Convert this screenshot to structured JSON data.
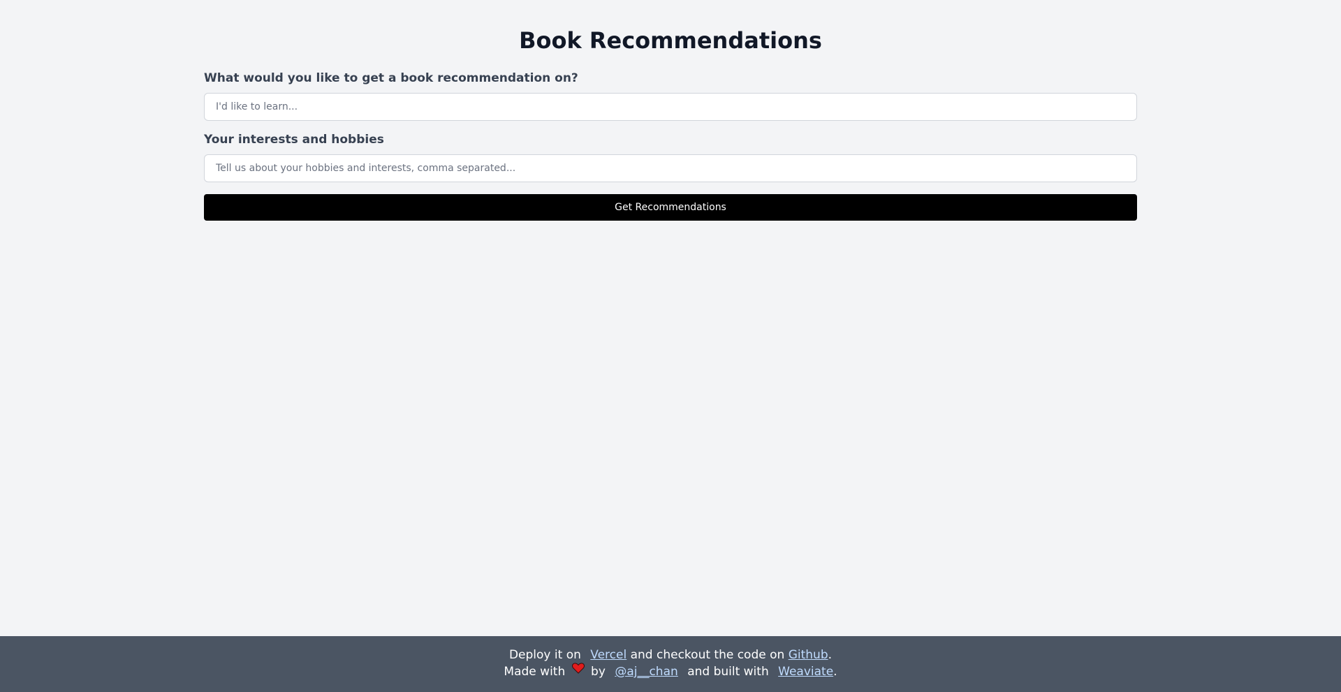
{
  "page": {
    "title": "Book Recommendations"
  },
  "form": {
    "topic_label": "What would you like to get a book recommendation on?",
    "topic_placeholder": "I'd like to learn...",
    "topic_value": "",
    "interests_label": "Your interests and hobbies",
    "interests_placeholder": "Tell us about your hobbies and interests, comma separated...",
    "interests_value": "",
    "submit_label": "Get Recommendations"
  },
  "footer": {
    "line1_prefix": "Deploy it on",
    "vercel_link": "Vercel",
    "line1_middle": "and checkout the code on",
    "github_link": "Github",
    "line1_suffix": ".",
    "line2_prefix": "Made with",
    "heart_icon": "heart-icon",
    "line2_by": "by",
    "author_link": "@aj__chan",
    "line2_middle": "and built with",
    "weaviate_link": "Weaviate",
    "line2_suffix": "."
  },
  "colors": {
    "background": "#f3f4f6",
    "button": "#000000",
    "footer": "#4b5563",
    "link": "#bfdbfe",
    "heart": "#e11d1d"
  }
}
